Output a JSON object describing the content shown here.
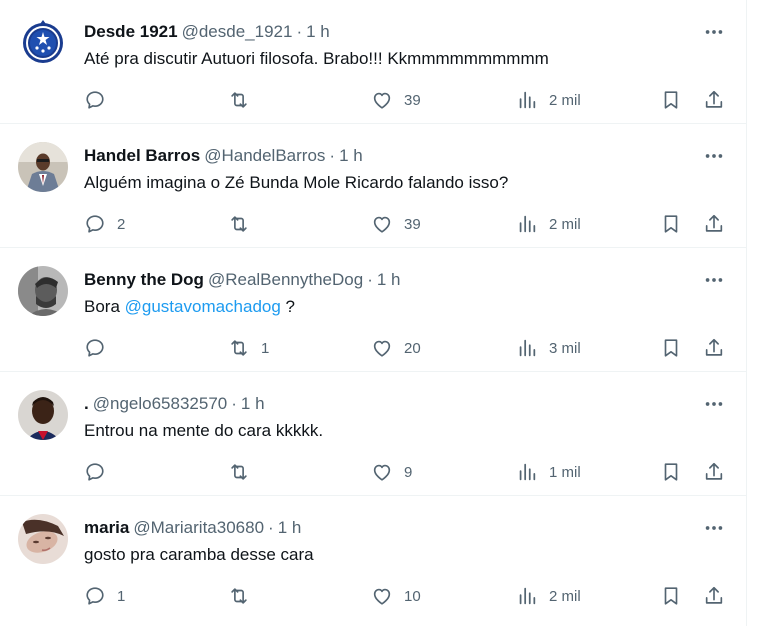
{
  "colors": {
    "accent": "#1d9bf0",
    "secondary_text": "#536471",
    "divider": "#eff3f4"
  },
  "icons": {
    "more": "more-horizontal-icon",
    "reply": "reply-icon",
    "retweet": "retweet-icon",
    "like": "heart-icon",
    "views": "views-chart-icon",
    "bookmark": "bookmark-icon",
    "share": "share-icon"
  },
  "tweets": [
    {
      "name": "Desde 1921",
      "handle": "@desde_1921",
      "dot": "·",
      "time": "1 h",
      "text": "Até pra discutir Autuori filosofa. Brabo!!! Kkmmmmmmmmmm",
      "replies": "",
      "retweets": "",
      "likes": "39",
      "views": "2 mil",
      "avatar": "cruzeiro-crest-avatar"
    },
    {
      "name": "Handel Barros",
      "handle": "@HandelBarros",
      "dot": "·",
      "time": "1 h",
      "text": "Alguém imagina o Zé Bunda Mole Ricardo falando isso?",
      "replies": "2",
      "retweets": "",
      "likes": "39",
      "views": "2 mil",
      "avatar": "man-in-suit-avatar"
    },
    {
      "name": "Benny the Dog",
      "handle": "@RealBennytheDog",
      "dot": "·",
      "time": "1 h",
      "text_prefix": "Bora ",
      "mention": "@gustavomachadog",
      "text_suffix": " ?",
      "replies": "",
      "retweets": "1",
      "likes": "20",
      "views": "3 mil",
      "avatar": "bw-portrait-avatar"
    },
    {
      "name": ".",
      "handle": "@ngelo65832570",
      "dot": "·",
      "time": "1 h",
      "text": "Entrou na mente do cara kkkkk.",
      "replies": "",
      "retweets": "",
      "likes": "9",
      "views": "1 mil",
      "avatar": "player-avatar"
    },
    {
      "name": "maria",
      "handle": "@Mariarita30680",
      "dot": "·",
      "time": "1 h",
      "text": "gosto pra caramba desse cara",
      "replies": "1",
      "retweets": "",
      "likes": "10",
      "views": "2 mil",
      "avatar": "woman-avatar"
    }
  ]
}
